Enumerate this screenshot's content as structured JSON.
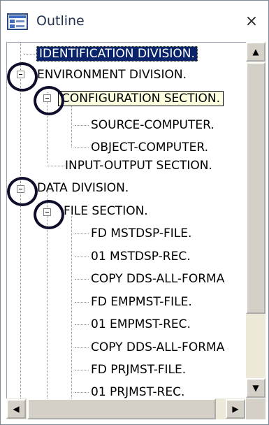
{
  "panel": {
    "title": "Outline",
    "close_glyph": "×",
    "title_icon": "outline-view-icon"
  },
  "tree": {
    "items": [
      {
        "label": "IDENTIFICATION DIVISION.",
        "level": 0,
        "state": "selected"
      },
      {
        "label": "ENVIRONMENT DIVISION.",
        "level": 0,
        "state": "expanded"
      },
      {
        "label": "CONFIGURATION SECTION.",
        "level": 1,
        "state": "expanded-hover"
      },
      {
        "label": "SOURCE-COMPUTER.",
        "level": 2,
        "state": "leaf"
      },
      {
        "label": "OBJECT-COMPUTER.",
        "level": 2,
        "state": "leaf"
      },
      {
        "label": "INPUT-OUTPUT SECTION.",
        "level": 1,
        "state": "leaf"
      },
      {
        "label": "DATA DIVISION.",
        "level": 0,
        "state": "expanded"
      },
      {
        "label": "FILE SECTION.",
        "level": 1,
        "state": "expanded"
      },
      {
        "label": "FD  MSTDSP-FILE.",
        "level": 2,
        "state": "leaf"
      },
      {
        "label": "01  MSTDSP-REC.",
        "level": 2,
        "state": "leaf"
      },
      {
        "label": "COPY DDS-ALL-FORMA",
        "level": 2,
        "state": "leaf"
      },
      {
        "label": "FD  EMPMST-FILE.",
        "level": 2,
        "state": "leaf"
      },
      {
        "label": "01  EMPMST-REC.",
        "level": 2,
        "state": "leaf"
      },
      {
        "label": "COPY DDS-ALL-FORMA",
        "level": 2,
        "state": "leaf"
      },
      {
        "label": "FD  PRJMST-FILE.",
        "level": 2,
        "state": "leaf"
      },
      {
        "label": "01  PRJMST-REC.",
        "level": 2,
        "state": "leaf"
      }
    ]
  },
  "scrollbars": {
    "up_glyph": "▲",
    "down_glyph": "▼",
    "left_glyph": "◀",
    "right_glyph": "▶"
  },
  "colors": {
    "selection": "#0a246a",
    "hover_bg": "#ffffe1",
    "annotation_circle": "#0e0e2c"
  }
}
